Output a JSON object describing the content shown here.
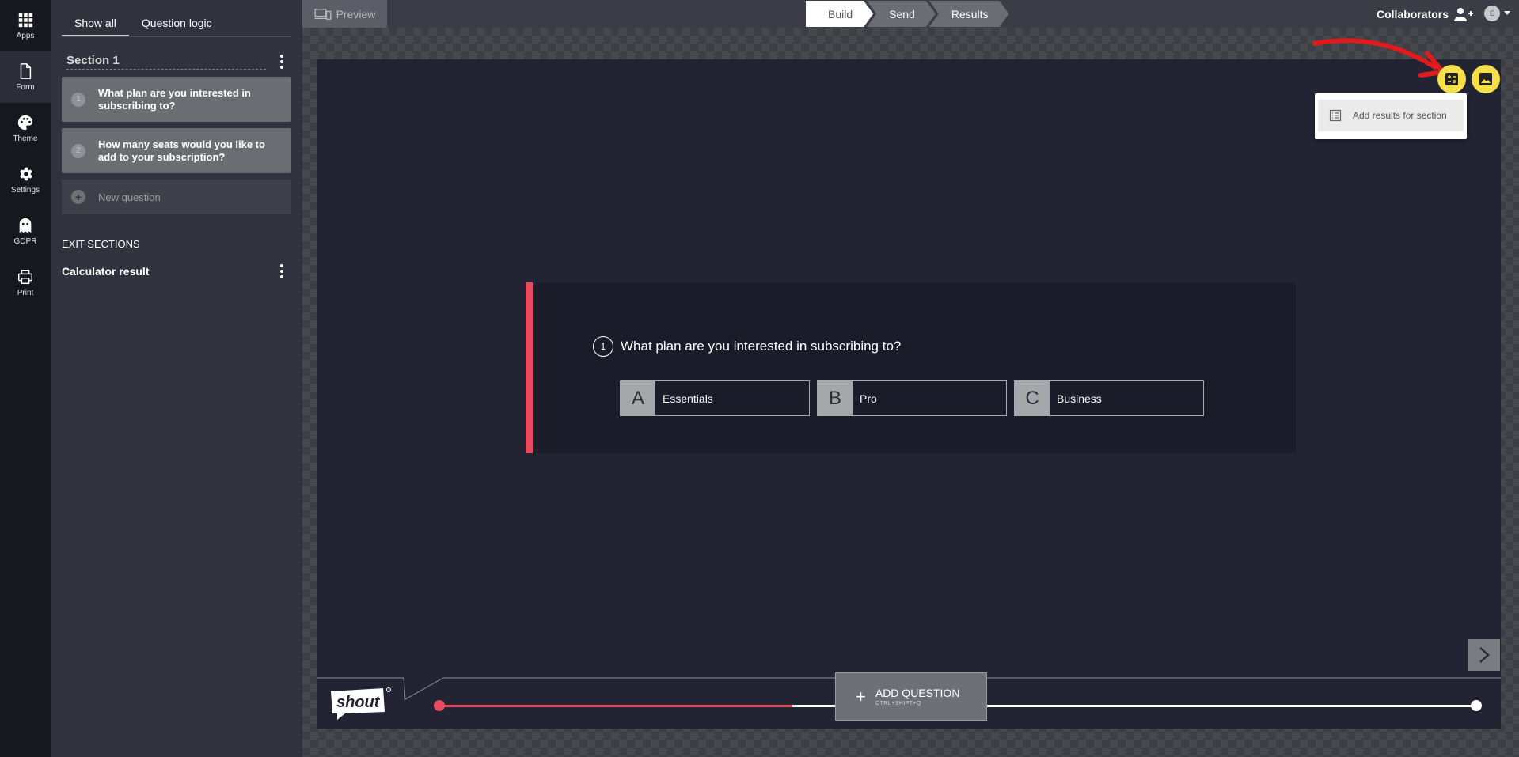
{
  "rail": [
    {
      "label": "Apps",
      "icon": "apps-icon"
    },
    {
      "label": "Form",
      "icon": "form-icon"
    },
    {
      "label": "Theme",
      "icon": "palette-icon"
    },
    {
      "label": "Settings",
      "icon": "gear-icon"
    },
    {
      "label": "GDPR",
      "icon": "ghost-icon"
    },
    {
      "label": "Print",
      "icon": "print-icon"
    }
  ],
  "sidebar": {
    "tabs": [
      "Show all",
      "Question logic"
    ],
    "section_title": "Section 1",
    "questions": [
      {
        "num": "1",
        "text": "What plan are you interested in subscribing to?"
      },
      {
        "num": "2",
        "text": "How many seats would you like to add to your subscription?"
      }
    ],
    "new_question": "New question",
    "exit_label": "EXIT SECTIONS",
    "exit_title": "Calculator result"
  },
  "topbar": {
    "preview": "Preview",
    "steps": [
      "Build",
      "Send",
      "Results"
    ],
    "collaborators": "Collaborators",
    "avatar_initial": "E"
  },
  "canvas": {
    "menu_item": "Add results for section",
    "question": {
      "num": "1",
      "text": "What plan are you interested in subscribing to?",
      "choices": [
        {
          "key": "A",
          "label": "Essentials"
        },
        {
          "key": "B",
          "label": "Pro"
        },
        {
          "key": "C",
          "label": "Business"
        }
      ]
    },
    "add_question": "ADD QUESTION",
    "add_question_shortcut": "CTRL+SHIFT+Q",
    "logo_text": "shout",
    "accent": "#e84a5f",
    "button_yellow": "#f5e04a",
    "progress_fraction": 0.34
  }
}
